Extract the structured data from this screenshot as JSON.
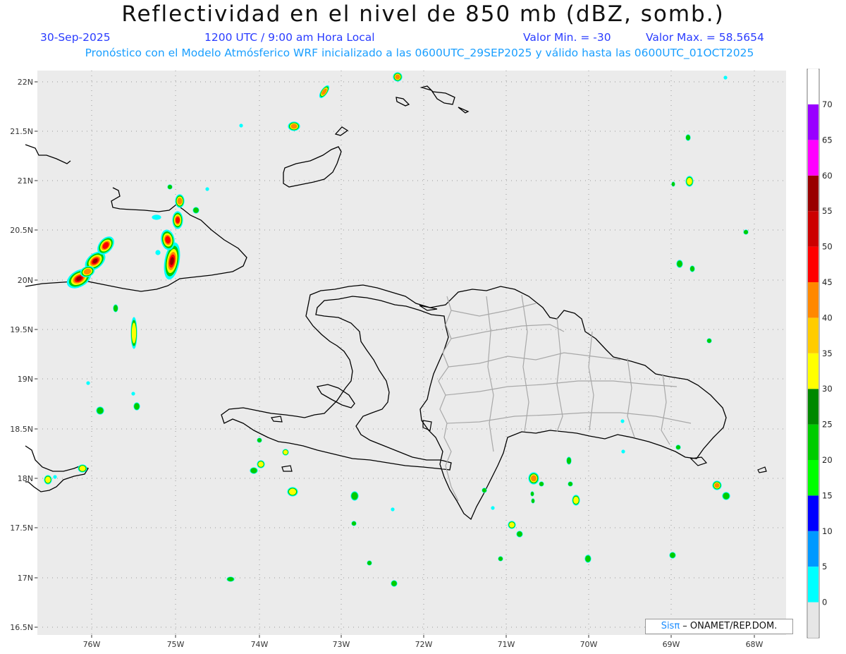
{
  "header": {
    "title": "Reflectividad en el nivel de 850 mb (dBZ, somb.)",
    "date": "30-Sep-2025",
    "time": "1200 UTC / 9:00 am Hora Local",
    "valmin": "Valor Min. = -30",
    "valmax": "Valor Max. = 58.5654",
    "forecast": "Pronóstico con el Modelo Atmósferico WRF inicializado a las 0600UTC_29SEP2025 y válido hasta las  0600UTC_01OCT2025"
  },
  "map": {
    "lat_labels": [
      "22N",
      "21.5N",
      "21N",
      "20.5N",
      "20N",
      "19.5N",
      "19N",
      "18.5N",
      "18N",
      "17.5N",
      "17N",
      "16.5N"
    ],
    "lon_labels": [
      "76W",
      "75W",
      "74W",
      "73W",
      "72W",
      "71W",
      "70W",
      "69W",
      "68W"
    ],
    "colors": {
      "land_fill": "#ebebeb",
      "coast": "#000000",
      "provinces": "#a8a8a8",
      "grid": "#9a9a9a"
    }
  },
  "colorbar": {
    "labels": [
      "0",
      "5",
      "10",
      "15",
      "20",
      "25",
      "30",
      "35",
      "40",
      "45",
      "50",
      "55",
      "60",
      "65",
      "70"
    ],
    "colors": [
      "#e6e6e6",
      "#00ffff",
      "#0099ff",
      "#0000ff",
      "#00ff00",
      "#00cc00",
      "#008800",
      "#ffff00",
      "#ffcc00",
      "#ff8800",
      "#ff0000",
      "#cc0000",
      "#990000",
      "#ff00ff",
      "#9900ff",
      "#ffffff"
    ]
  },
  "credit": {
    "sis": "Sisπ",
    "text": " – ONAMET/REP.DOM."
  }
}
